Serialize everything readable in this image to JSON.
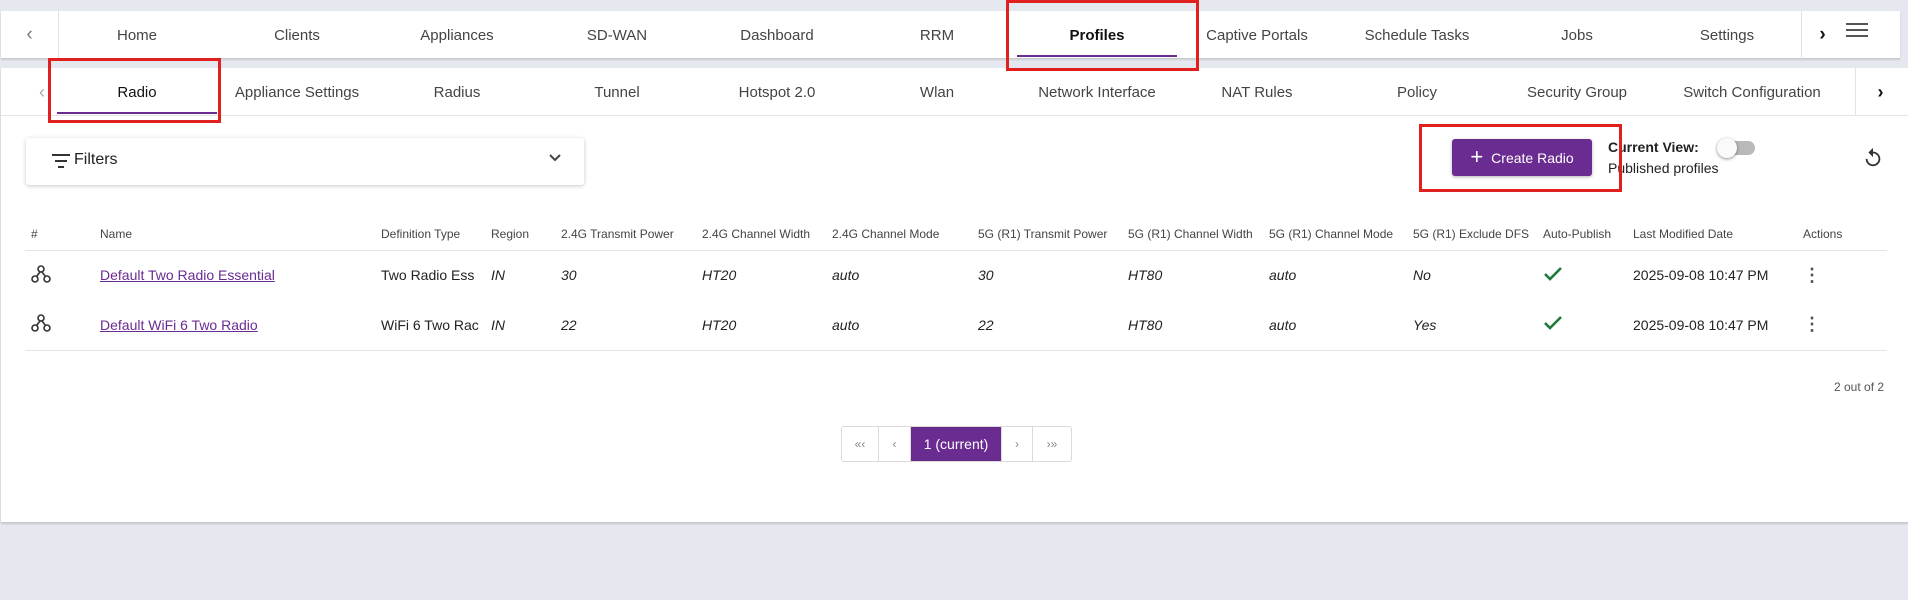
{
  "topnav": {
    "tabs": [
      "Home",
      "Clients",
      "Appliances",
      "SD-WAN",
      "Dashboard",
      "RRM",
      "Profiles",
      "Captive Portals",
      "Schedule Tasks",
      "Jobs",
      "Settings"
    ],
    "active": "Profiles",
    "left_arrow": "‹",
    "right_arrow": "›"
  },
  "subnav": {
    "tabs": [
      "Radio",
      "Appliance Settings",
      "Radius",
      "Tunnel",
      "Hotspot 2.0",
      "Wlan",
      "Network Interface",
      "NAT Rules",
      "Policy",
      "Security Group",
      "Switch Configuration"
    ],
    "active": "Radio",
    "left_arrow": "‹",
    "right_arrow": "›"
  },
  "filters": {
    "label": "Filters"
  },
  "create_button": {
    "label": "Create Radio"
  },
  "current_view": {
    "label": "Current View:",
    "value": "Published profiles",
    "toggle_on": false
  },
  "table": {
    "headers": [
      "#",
      "Name",
      "Definition Type",
      "Region",
      "2.4G Transmit Power",
      "2.4G Channel Width",
      "2.4G Channel Mode",
      "5G (R1) Transmit Power",
      "5G (R1) Channel Width",
      "5G (R1) Channel Mode",
      "5G (R1) Exclude DFS",
      "Auto-Publish",
      "Last Modified Date",
      "Actions"
    ],
    "rows": [
      {
        "name": "Default Two Radio Essential",
        "definition_type": "Two Radio Ess",
        "region": "IN",
        "tx24": "30",
        "cw24": "HT20",
        "cm24": "auto",
        "tx5": "30",
        "cw5": "HT80",
        "cm5": "auto",
        "dfs": "No",
        "auto_publish": true,
        "modified": "2025-09-08 10:47 PM"
      },
      {
        "name": "Default WiFi 6 Two Radio",
        "definition_type": "WiFi 6 Two Rac",
        "region": "IN",
        "tx24": "22",
        "cw24": "HT20",
        "cm24": "auto",
        "tx5": "22",
        "cw5": "HT80",
        "cm5": "auto",
        "dfs": "Yes",
        "auto_publish": true,
        "modified": "2025-09-08 10:47 PM"
      }
    ]
  },
  "record_count": "2 out of 2",
  "pagination": {
    "first": "«‹",
    "prev": "‹",
    "current": "1 (current)",
    "next": "›",
    "last": "›»"
  },
  "colors": {
    "accent": "#6a2c91",
    "check": "#1e7a3a",
    "highlight": "#e01f1f",
    "background": "#e6e8ef"
  },
  "icons": {
    "row": "hierarchy-node-icon",
    "auto_publish": "checkmark-icon",
    "actions": "kebab-menu-icon",
    "refresh": "refresh-icon",
    "menu": "hamburger-icon",
    "filter": "filter-lines-icon"
  }
}
